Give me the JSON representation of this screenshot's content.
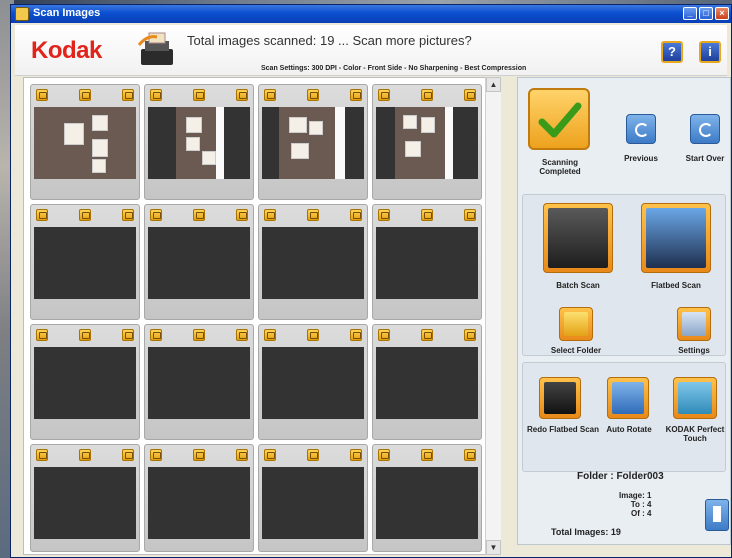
{
  "window": {
    "title": "Scan Images"
  },
  "header": {
    "logo": "Kodak",
    "message": "Total images scanned: 19 ... Scan more pictures?",
    "settings": "Scan Settings: 300 DPI - Color - Front Side - No Sharpening - Best Compression",
    "help": "?",
    "info": "i"
  },
  "panel": {
    "scanning_completed": "Scanning Completed",
    "previous": "Previous",
    "start_over": "Start Over",
    "batch_scan": "Batch Scan",
    "flatbed_scan": "Flatbed Scan",
    "select_folder": "Select Folder",
    "settings": "Settings",
    "redo_flatbed": "Redo Flatbed Scan",
    "auto_rotate": "Auto Rotate",
    "perfect_touch": "KODAK Perfect Touch"
  },
  "footer": {
    "folder": "Folder : Folder003",
    "image_label": "Image:",
    "image_value": "1",
    "to_label": "To :",
    "to_value": "4",
    "of_label": "Of :",
    "of_value": "4",
    "total": "Total Images: 19"
  },
  "icons": {
    "check": "check-icon",
    "thumb_actions": [
      "rotate-left-icon",
      "edit-icon",
      "rotate-right-icon"
    ]
  },
  "colors": {
    "accent": "#e8a81e",
    "brand": "#e2231a",
    "title_bar": "#0b4fd0"
  }
}
